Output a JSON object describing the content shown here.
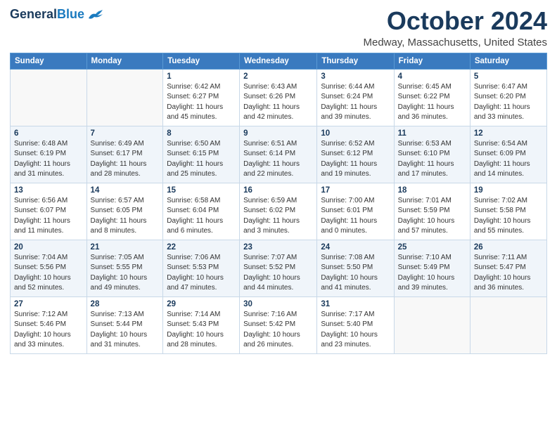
{
  "header": {
    "logo_line1": "General",
    "logo_line2": "Blue",
    "month": "October 2024",
    "location": "Medway, Massachusetts, United States"
  },
  "weekdays": [
    "Sunday",
    "Monday",
    "Tuesday",
    "Wednesday",
    "Thursday",
    "Friday",
    "Saturday"
  ],
  "weeks": [
    [
      {
        "day": "",
        "info": ""
      },
      {
        "day": "",
        "info": ""
      },
      {
        "day": "1",
        "info": "Sunrise: 6:42 AM\nSunset: 6:27 PM\nDaylight: 11 hours and 45 minutes."
      },
      {
        "day": "2",
        "info": "Sunrise: 6:43 AM\nSunset: 6:26 PM\nDaylight: 11 hours and 42 minutes."
      },
      {
        "day": "3",
        "info": "Sunrise: 6:44 AM\nSunset: 6:24 PM\nDaylight: 11 hours and 39 minutes."
      },
      {
        "day": "4",
        "info": "Sunrise: 6:45 AM\nSunset: 6:22 PM\nDaylight: 11 hours and 36 minutes."
      },
      {
        "day": "5",
        "info": "Sunrise: 6:47 AM\nSunset: 6:20 PM\nDaylight: 11 hours and 33 minutes."
      }
    ],
    [
      {
        "day": "6",
        "info": "Sunrise: 6:48 AM\nSunset: 6:19 PM\nDaylight: 11 hours and 31 minutes."
      },
      {
        "day": "7",
        "info": "Sunrise: 6:49 AM\nSunset: 6:17 PM\nDaylight: 11 hours and 28 minutes."
      },
      {
        "day": "8",
        "info": "Sunrise: 6:50 AM\nSunset: 6:15 PM\nDaylight: 11 hours and 25 minutes."
      },
      {
        "day": "9",
        "info": "Sunrise: 6:51 AM\nSunset: 6:14 PM\nDaylight: 11 hours and 22 minutes."
      },
      {
        "day": "10",
        "info": "Sunrise: 6:52 AM\nSunset: 6:12 PM\nDaylight: 11 hours and 19 minutes."
      },
      {
        "day": "11",
        "info": "Sunrise: 6:53 AM\nSunset: 6:10 PM\nDaylight: 11 hours and 17 minutes."
      },
      {
        "day": "12",
        "info": "Sunrise: 6:54 AM\nSunset: 6:09 PM\nDaylight: 11 hours and 14 minutes."
      }
    ],
    [
      {
        "day": "13",
        "info": "Sunrise: 6:56 AM\nSunset: 6:07 PM\nDaylight: 11 hours and 11 minutes."
      },
      {
        "day": "14",
        "info": "Sunrise: 6:57 AM\nSunset: 6:05 PM\nDaylight: 11 hours and 8 minutes."
      },
      {
        "day": "15",
        "info": "Sunrise: 6:58 AM\nSunset: 6:04 PM\nDaylight: 11 hours and 6 minutes."
      },
      {
        "day": "16",
        "info": "Sunrise: 6:59 AM\nSunset: 6:02 PM\nDaylight: 11 hours and 3 minutes."
      },
      {
        "day": "17",
        "info": "Sunrise: 7:00 AM\nSunset: 6:01 PM\nDaylight: 11 hours and 0 minutes."
      },
      {
        "day": "18",
        "info": "Sunrise: 7:01 AM\nSunset: 5:59 PM\nDaylight: 10 hours and 57 minutes."
      },
      {
        "day": "19",
        "info": "Sunrise: 7:02 AM\nSunset: 5:58 PM\nDaylight: 10 hours and 55 minutes."
      }
    ],
    [
      {
        "day": "20",
        "info": "Sunrise: 7:04 AM\nSunset: 5:56 PM\nDaylight: 10 hours and 52 minutes."
      },
      {
        "day": "21",
        "info": "Sunrise: 7:05 AM\nSunset: 5:55 PM\nDaylight: 10 hours and 49 minutes."
      },
      {
        "day": "22",
        "info": "Sunrise: 7:06 AM\nSunset: 5:53 PM\nDaylight: 10 hours and 47 minutes."
      },
      {
        "day": "23",
        "info": "Sunrise: 7:07 AM\nSunset: 5:52 PM\nDaylight: 10 hours and 44 minutes."
      },
      {
        "day": "24",
        "info": "Sunrise: 7:08 AM\nSunset: 5:50 PM\nDaylight: 10 hours and 41 minutes."
      },
      {
        "day": "25",
        "info": "Sunrise: 7:10 AM\nSunset: 5:49 PM\nDaylight: 10 hours and 39 minutes."
      },
      {
        "day": "26",
        "info": "Sunrise: 7:11 AM\nSunset: 5:47 PM\nDaylight: 10 hours and 36 minutes."
      }
    ],
    [
      {
        "day": "27",
        "info": "Sunrise: 7:12 AM\nSunset: 5:46 PM\nDaylight: 10 hours and 33 minutes."
      },
      {
        "day": "28",
        "info": "Sunrise: 7:13 AM\nSunset: 5:44 PM\nDaylight: 10 hours and 31 minutes."
      },
      {
        "day": "29",
        "info": "Sunrise: 7:14 AM\nSunset: 5:43 PM\nDaylight: 10 hours and 28 minutes."
      },
      {
        "day": "30",
        "info": "Sunrise: 7:16 AM\nSunset: 5:42 PM\nDaylight: 10 hours and 26 minutes."
      },
      {
        "day": "31",
        "info": "Sunrise: 7:17 AM\nSunset: 5:40 PM\nDaylight: 10 hours and 23 minutes."
      },
      {
        "day": "",
        "info": ""
      },
      {
        "day": "",
        "info": ""
      }
    ]
  ]
}
